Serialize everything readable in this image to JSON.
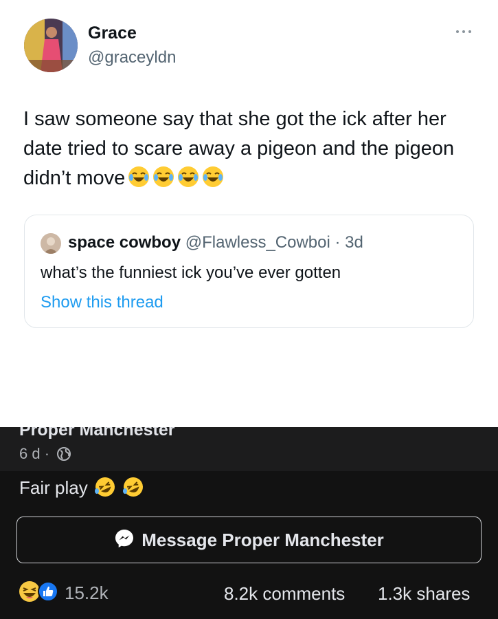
{
  "tweet": {
    "author_name": "Grace",
    "author_handle": "@graceyldn",
    "text": "I saw someone say that she got the ick after her date tried to scare away a pigeon and the pigeon didn’t move",
    "emojis": [
      "face-with-tears-of-joy",
      "face-with-tears-of-joy",
      "face-with-tears-of-joy",
      "face-with-tears-of-joy"
    ],
    "more_icon": "ellipsis-icon",
    "quote": {
      "author_name": "space cowboy",
      "author_meta": "@Flawless_Cowboi · 3d",
      "text": "what’s the funniest ick you’ve ever gotten",
      "link": "Show this thread",
      "link_color": "#1d9bf0"
    }
  },
  "post": {
    "page_name": "Proper Manchester",
    "time": "6 d ·",
    "privacy_icon": "globe-icon",
    "caption": "Fair play",
    "caption_emojis": [
      "rolling-on-the-floor-laughing",
      "rolling-on-the-floor-laughing"
    ],
    "message_button": "Message Proper Manchester",
    "reaction_icons": [
      "haha-reaction",
      "like-reaction"
    ],
    "reaction_count": "15.2k",
    "comments": "8.2k comments",
    "shares": "1.3k shares",
    "like_color": "#1877f2"
  }
}
